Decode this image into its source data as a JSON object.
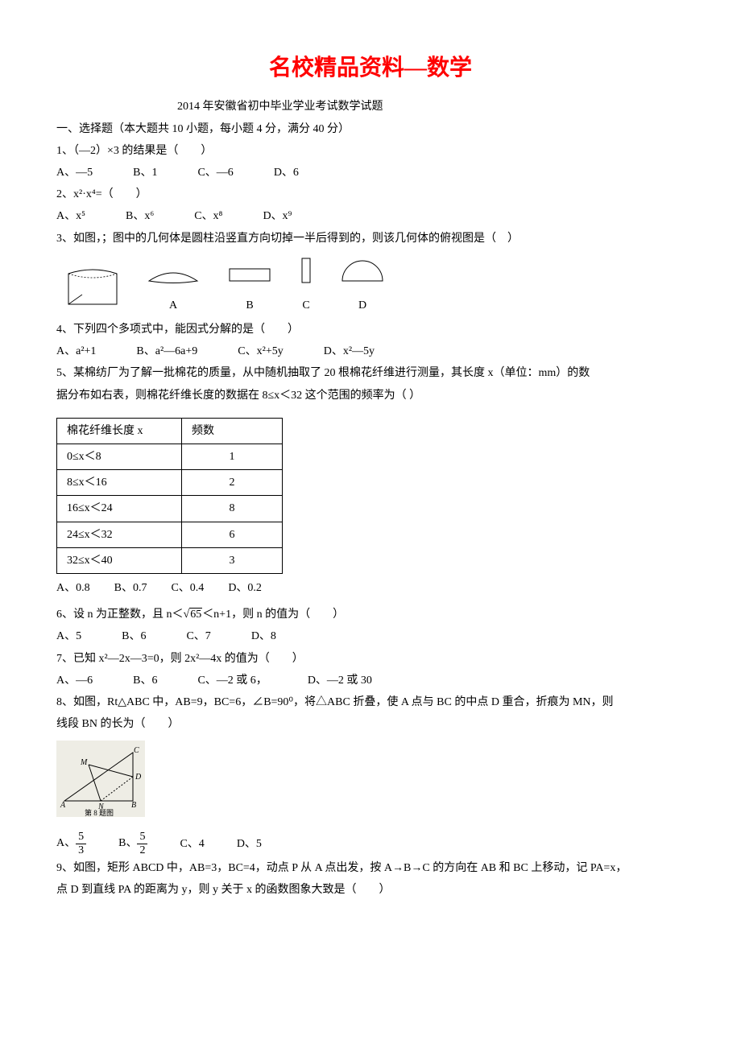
{
  "mainTitle": "名校精品资料—数学",
  "subTitle": "2014 年安徽省初中毕业学业考试数学试题",
  "section1": "一、选择题（本大题共 10 小题，每小题 4 分，满分 40 分）",
  "q1": {
    "text": "1、（—2）×3 的结果是（　　）",
    "a": "A、—5",
    "b": "B、1",
    "c": "C、—6",
    "d": "D、6"
  },
  "q2": {
    "text": "2、x²·x⁴=（　　）",
    "a": "A、x⁵",
    "b": "B、x⁶",
    "c": "C、x⁸",
    "d": "D、x⁹"
  },
  "q3": {
    "text": "3、如图，；图中的几何体是圆柱沿竖直方向切掉一半后得到的，则该几何体的俯视图是（　）",
    "labA": "A",
    "labB": "B",
    "labC": "C",
    "labD": "D"
  },
  "q4": {
    "text": "4、下列四个多项式中，能因式分解的是（　　）",
    "a": "A、a²+1",
    "b": "B、a²—6a+9",
    "c": "C、x²+5y",
    "d": "D、x²—5y"
  },
  "q5": {
    "text1": "5、某棉纺厂为了解一批棉花的质量，从中随机抽取了 20 根棉花纤维进行测量，其长度 x（单位：mm）的数",
    "text2": "据分布如右表，则棉花纤维长度的数据在 8≤x＜32 这个范围的频率为（  ）",
    "th1": "棉花纤维长度 x",
    "th2": "频数",
    "r1c1": "0≤x＜8",
    "r1c2": "1",
    "r2c1": "8≤x＜16",
    "r2c2": "2",
    "r3c1": "16≤x＜24",
    "r3c2": "8",
    "r4c1": "24≤x＜32",
    "r4c2": "6",
    "r5c1": "32≤x＜40",
    "r5c2": "3",
    "a": "A、0.8",
    "b": "B、0.7",
    "c": "C、0.4",
    "d": "D、0.2"
  },
  "q6": {
    "pre": "6、设 n 为正整数，且 n＜",
    "sqrtVal": "65",
    "post": "＜n+1，则 n 的值为（　　）",
    "a": "A、5",
    "b": "B、6",
    "c": "C、7",
    "d": "D、8"
  },
  "q7": {
    "text": "7、已知 x²—2x—3=0，则 2x²—4x 的值为（　　）",
    "a": "A、—6",
    "b": "B、6",
    "c": "C、—2 或 6，",
    "d": "D、—2 或 30"
  },
  "q8": {
    "text1": "8、如图，Rt△ABC 中，AB=9，BC=6，∠B=90⁰，将△ABC 折叠，使 A 点与 BC 的中点 D 重合，折痕为 MN，则",
    "text2": "线段 BN 的长为（　　）",
    "aPre": "A、",
    "aNum": "5",
    "aDen": "3",
    "bPre": "B、",
    "bNum": "5",
    "bDen": "2",
    "c": "C、4",
    "d": "D、5"
  },
  "q9": {
    "text1": "9、如图，矩形 ABCD 中，AB=3，BC=4，动点 P 从 A 点出发，按 A→B→C 的方向在 AB 和 BC 上移动，记 PA=x，",
    "text2": "点 D 到直线 PA 的距离为 y，则 y 关于 x 的函数图象大致是（　　）"
  }
}
